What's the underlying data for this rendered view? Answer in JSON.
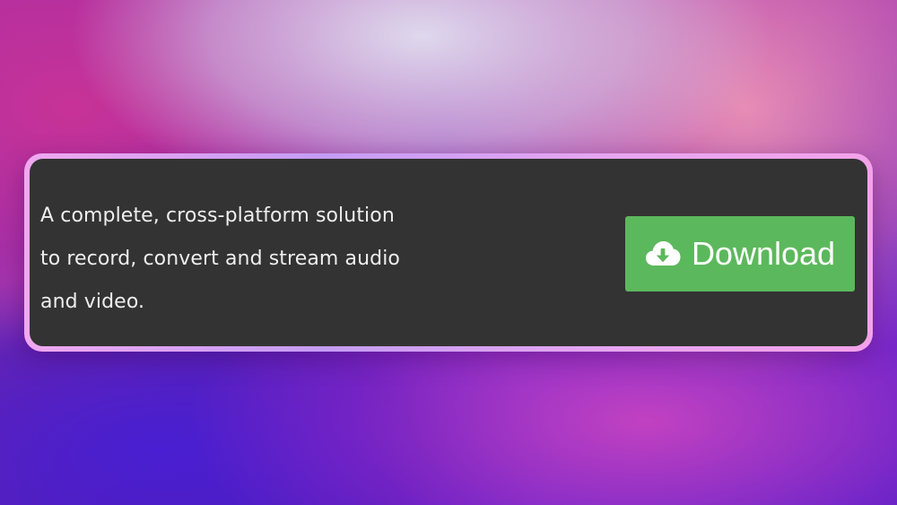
{
  "banner": {
    "tagline_lines": [
      "A complete, cross-platform solution",
      "to record, convert and stream audio",
      "and video."
    ],
    "download": {
      "label": "Download",
      "icon": "cloud-download-icon",
      "color": "#5cb85c"
    }
  },
  "theme": {
    "panel_color": "#333333",
    "border_color": "#e7a6f0"
  }
}
